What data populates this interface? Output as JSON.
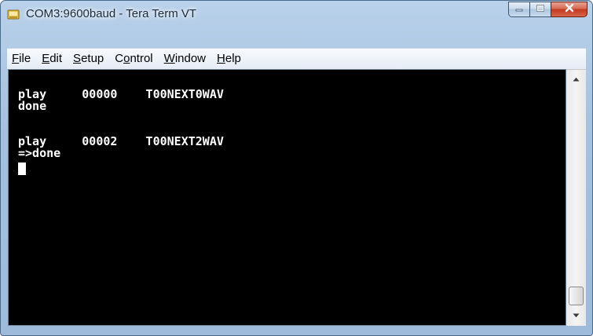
{
  "window": {
    "title": "COM3:9600baud - Tera Term VT",
    "app_icon": "tera-term-icon",
    "colors": {
      "frame": "#a4c0de",
      "close_button": "#c23a1f",
      "terminal_background": "#000000",
      "terminal_text": "#ffffff"
    }
  },
  "caption_buttons": {
    "minimize_icon": "minimize-icon",
    "maximize_icon": "maximize-icon",
    "close_icon": "close-icon"
  },
  "menu": {
    "items": [
      {
        "pre": "",
        "key": "F",
        "post": "ile"
      },
      {
        "pre": "",
        "key": "E",
        "post": "dit"
      },
      {
        "pre": "",
        "key": "S",
        "post": "etup"
      },
      {
        "pre": "C",
        "key": "o",
        "post": "ntrol"
      },
      {
        "pre": "",
        "key": "W",
        "post": "indow"
      },
      {
        "pre": "",
        "key": "H",
        "post": "elp"
      }
    ]
  },
  "terminal": {
    "lines": [
      "play     00000    T00NEXT0WAV",
      "done",
      "",
      "play     00002    T00NEXT2WAV",
      "=>done"
    ],
    "cursor": "block-cursor"
  },
  "scrollbar": {
    "up_icon": "scroll-up-arrow-icon",
    "down_icon": "scroll-down-arrow-icon"
  }
}
